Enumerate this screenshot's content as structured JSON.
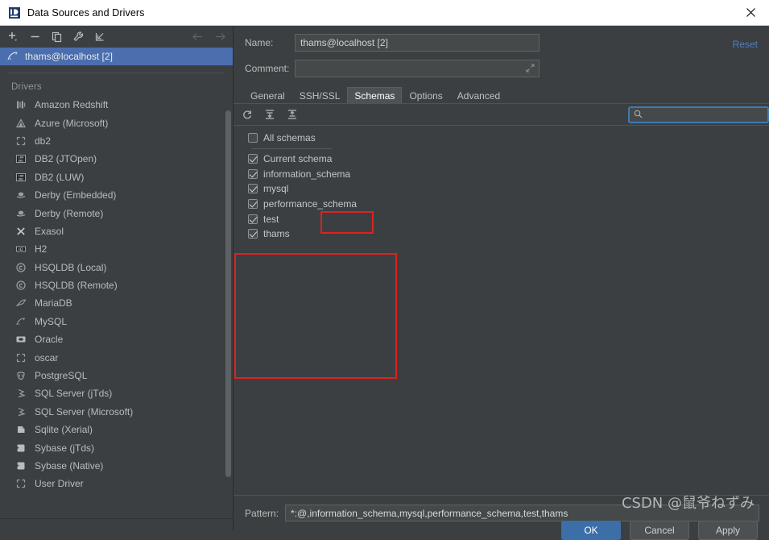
{
  "window": {
    "title": "Data Sources and Drivers",
    "app_icon": "datagrip-icon",
    "close_label": "✕"
  },
  "left_panel": {
    "toolbar": [
      {
        "name": "add-data-source-button",
        "glyph": "+"
      },
      {
        "name": "remove-data-source-button",
        "glyph": "−"
      },
      {
        "name": "duplicate-data-source-button",
        "glyph": "copy"
      },
      {
        "name": "properties-button",
        "glyph": "wrench"
      },
      {
        "name": "import-button",
        "glyph": "import"
      }
    ],
    "nav": [
      {
        "name": "nav-back-button",
        "glyph": "←"
      },
      {
        "name": "nav-forward-button",
        "glyph": "→"
      }
    ],
    "data_sources": [
      {
        "label": "thams@localhost [2]",
        "icon": "mysql-icon",
        "selected": true
      }
    ],
    "drivers_header": "Drivers",
    "drivers": [
      {
        "label": "Amazon Redshift",
        "icon": "redshift-icon"
      },
      {
        "label": "Azure (Microsoft)",
        "icon": "azure-icon"
      },
      {
        "label": "db2",
        "icon": "generic-db-icon"
      },
      {
        "label": "DB2 (JTOpen)",
        "icon": "ibm-db2-icon"
      },
      {
        "label": "DB2 (LUW)",
        "icon": "ibm-db2-icon"
      },
      {
        "label": "Derby (Embedded)",
        "icon": "derby-icon"
      },
      {
        "label": "Derby (Remote)",
        "icon": "derby-icon"
      },
      {
        "label": "Exasol",
        "icon": "exasol-icon"
      },
      {
        "label": "H2",
        "icon": "h2-icon"
      },
      {
        "label": "HSQLDB (Local)",
        "icon": "hsqldb-icon"
      },
      {
        "label": "HSQLDB (Remote)",
        "icon": "hsqldb-icon"
      },
      {
        "label": "MariaDB",
        "icon": "mariadb-icon"
      },
      {
        "label": "MySQL",
        "icon": "mysql-icon"
      },
      {
        "label": "Oracle",
        "icon": "oracle-icon"
      },
      {
        "label": "oscar",
        "icon": "generic-db-icon"
      },
      {
        "label": "PostgreSQL",
        "icon": "postgresql-icon"
      },
      {
        "label": "SQL Server (jTds)",
        "icon": "sqlserver-icon"
      },
      {
        "label": "SQL Server (Microsoft)",
        "icon": "sqlserver-icon"
      },
      {
        "label": "Sqlite (Xerial)",
        "icon": "sqlite-icon"
      },
      {
        "label": "Sybase (jTds)",
        "icon": "sybase-icon"
      },
      {
        "label": "Sybase (Native)",
        "icon": "sybase-icon"
      },
      {
        "label": "User Driver",
        "icon": "generic-db-icon"
      }
    ]
  },
  "right_panel": {
    "name_label": "Name:",
    "name_value": "thams@localhost [2]",
    "comment_label": "Comment:",
    "comment_value": "",
    "comment_placeholder": "",
    "reset_label": "Reset",
    "tabs": [
      {
        "label": "General",
        "active": false
      },
      {
        "label": "SSH/SSL",
        "active": false
      },
      {
        "label": "Schemas",
        "active": true
      },
      {
        "label": "Options",
        "active": false
      },
      {
        "label": "Advanced",
        "active": false
      }
    ],
    "schemas_toolbar": [
      {
        "name": "refresh-icon",
        "glyph": "refresh"
      },
      {
        "name": "expand-all-icon",
        "glyph": "expand"
      },
      {
        "name": "collapse-all-icon",
        "glyph": "collapse"
      }
    ],
    "search": {
      "value": "",
      "placeholder": "",
      "icon": "search-icon"
    },
    "schema_items": [
      {
        "label": "All schemas",
        "checked": false
      },
      {
        "label": "Current schema",
        "checked": true
      },
      {
        "label": "information_schema",
        "checked": true
      },
      {
        "label": "mysql",
        "checked": true
      },
      {
        "label": "performance_schema",
        "checked": true
      },
      {
        "label": "test",
        "checked": true
      },
      {
        "label": "thams",
        "checked": true
      }
    ],
    "pattern_label": "Pattern:",
    "pattern_value": "*:@,information_schema,mysql,performance_schema,test,thams"
  },
  "footer": {
    "buttons": [
      {
        "label": "OK",
        "primary": true
      },
      {
        "label": "Cancel",
        "primary": false
      },
      {
        "label": "Apply",
        "primary": false
      }
    ]
  },
  "watermark": {
    "text": "CSDN @鼠爷ねずみ"
  },
  "colors": {
    "background": "#3c3f41",
    "selection_blue": "#4b6eaf",
    "accent_blue": "#4e7fc4",
    "focus_blue": "#3d7ab5",
    "annotation_red": "#e02020",
    "titlebar": "#ffffff"
  }
}
